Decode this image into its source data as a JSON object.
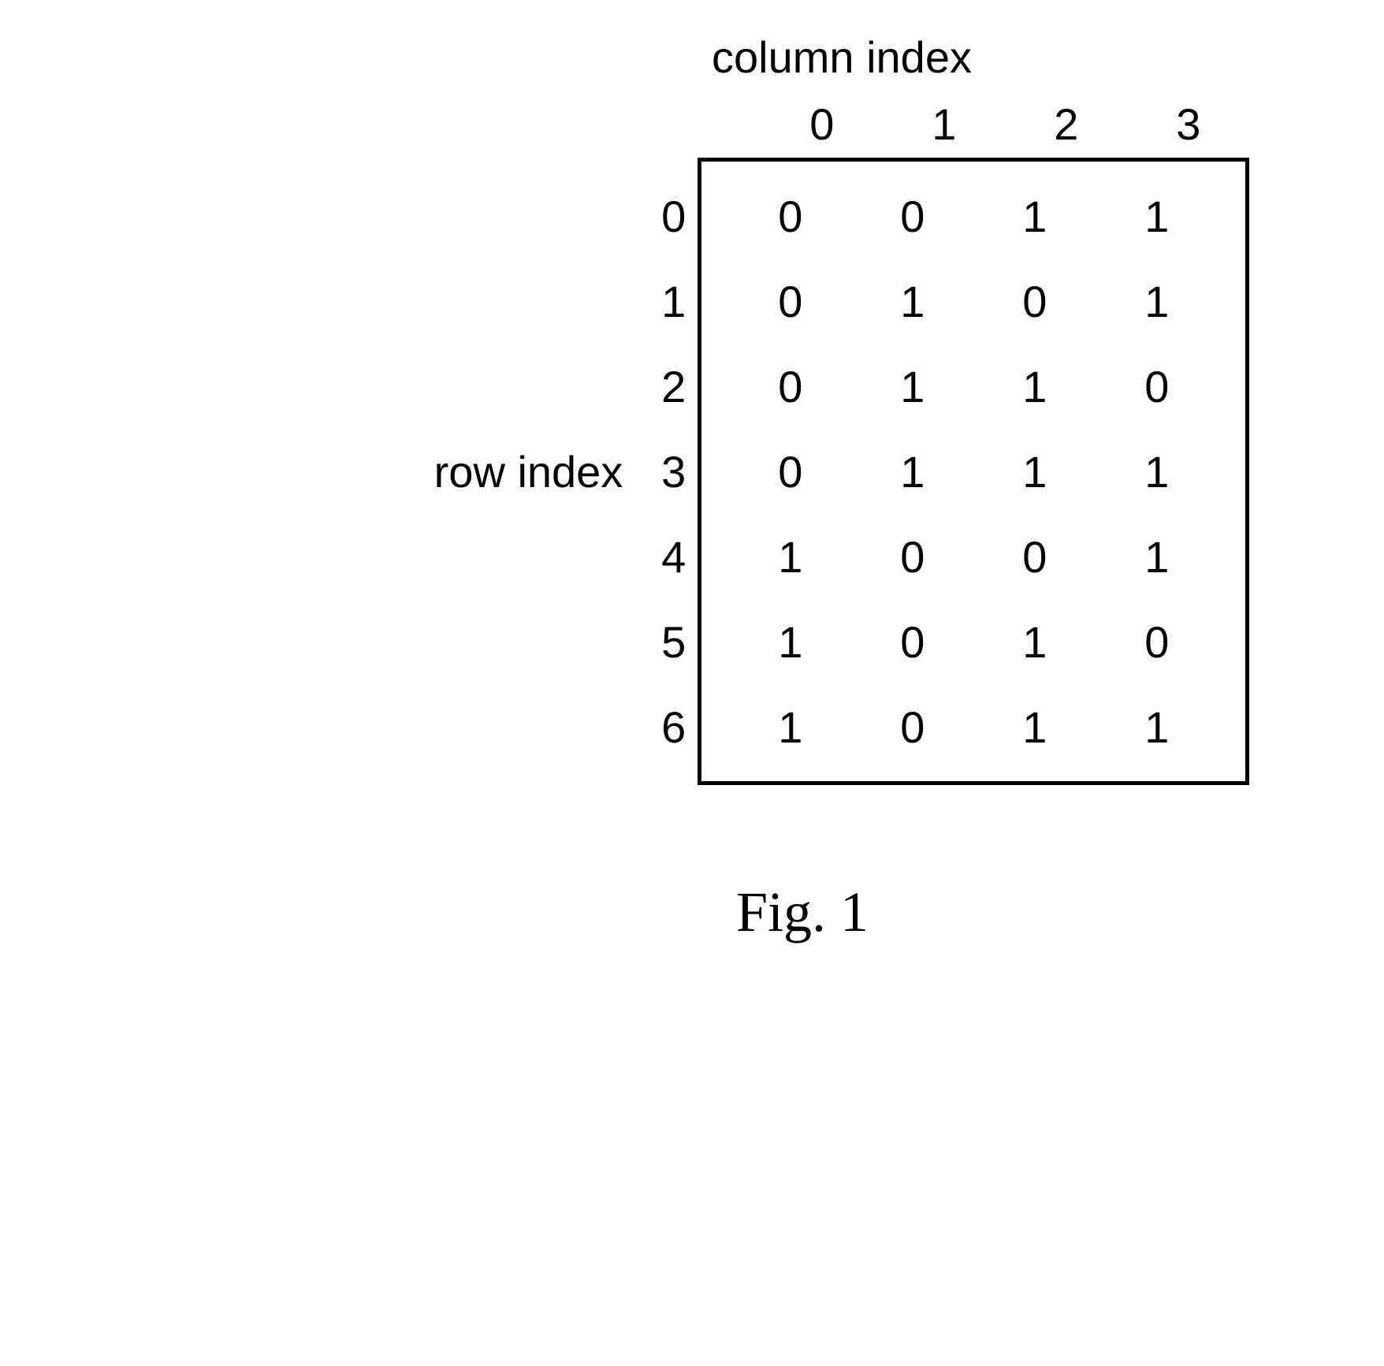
{
  "chart_data": {
    "type": "table",
    "column_title": "column index",
    "row_title": "row index",
    "column_headers": [
      "0",
      "1",
      "2",
      "3"
    ],
    "row_headers": [
      "0",
      "1",
      "2",
      "3",
      "4",
      "5",
      "6"
    ],
    "rows": [
      [
        "0",
        "0",
        "1",
        "1"
      ],
      [
        "0",
        "1",
        "0",
        "1"
      ],
      [
        "0",
        "1",
        "1",
        "0"
      ],
      [
        "0",
        "1",
        "1",
        "1"
      ],
      [
        "1",
        "0",
        "0",
        "1"
      ],
      [
        "1",
        "0",
        "1",
        "0"
      ],
      [
        "1",
        "0",
        "1",
        "1"
      ]
    ],
    "caption": "Fig. 1"
  }
}
